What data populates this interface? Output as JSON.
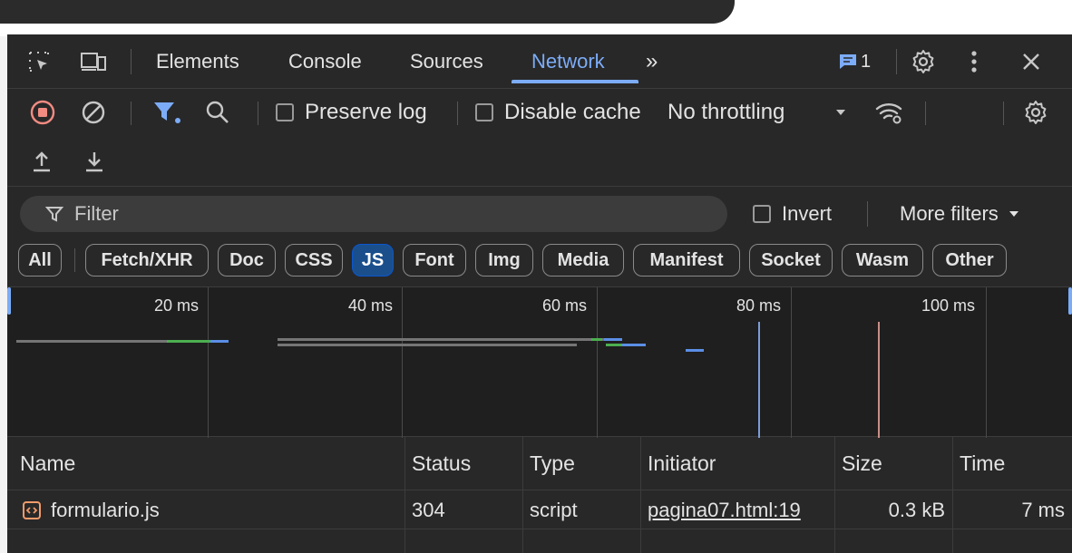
{
  "tabs": {
    "items": [
      {
        "label": "Elements"
      },
      {
        "label": "Console"
      },
      {
        "label": "Sources"
      },
      {
        "label": "Network"
      }
    ],
    "more_label": "»",
    "issues_count": "1"
  },
  "toolbar": {
    "preserve_log_label": "Preserve log",
    "disable_cache_label": "Disable cache",
    "throttling_value": "No throttling"
  },
  "filter": {
    "placeholder": "Filter",
    "invert_label": "Invert",
    "more_filters_label": "More filters"
  },
  "type_filters": [
    "All",
    "Fetch/XHR",
    "Doc",
    "CSS",
    "JS",
    "Font",
    "Img",
    "Media",
    "Manifest",
    "Socket",
    "Wasm",
    "Other"
  ],
  "active_type_filter": "JS",
  "timeline": {
    "ticks": [
      "20 ms",
      "40 ms",
      "60 ms",
      "80 ms",
      "100 ms"
    ]
  },
  "table": {
    "columns": [
      "Name",
      "Status",
      "Type",
      "Initiator",
      "Size",
      "Time"
    ],
    "rows": [
      {
        "name": "formulario.js",
        "status": "304",
        "type": "script",
        "initiator": "pagina07.html:19",
        "size": "0.3 kB",
        "time": "7 ms"
      }
    ]
  },
  "colors": {
    "accent": "#7cacf8",
    "record": "#f28b82",
    "background": "#282828"
  }
}
